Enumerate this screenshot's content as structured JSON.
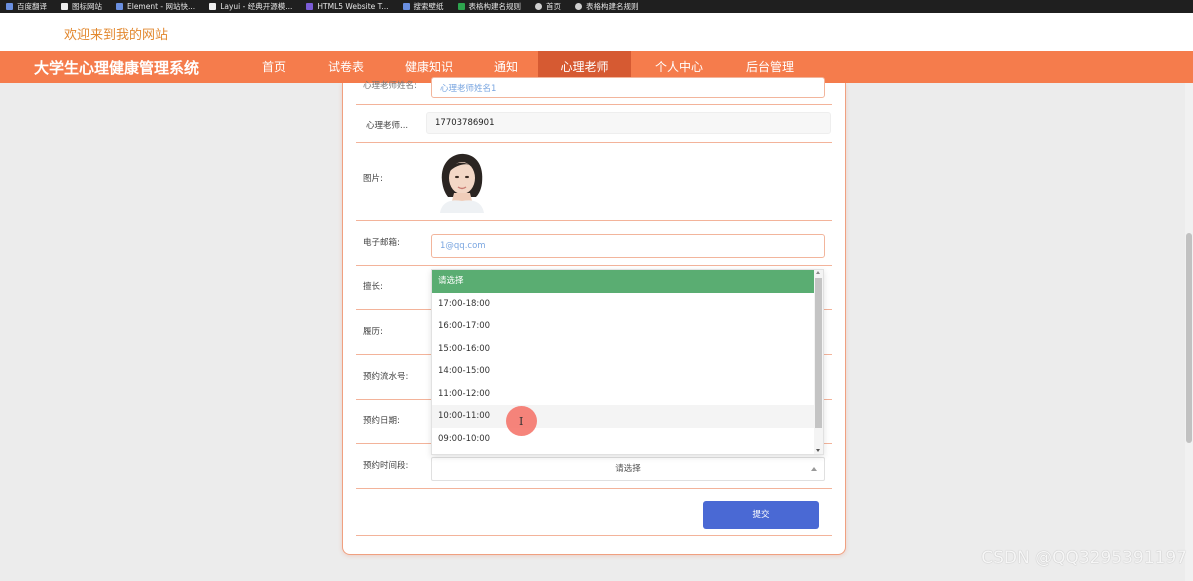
{
  "bookmarks": [
    {
      "label": "百度翻译",
      "icon": "paw-icon"
    },
    {
      "label": "图标网站",
      "icon": "page-icon"
    },
    {
      "label": "Element - 网站快...",
      "icon": "shield-icon"
    },
    {
      "label": "Layui - 经典开源模...",
      "icon": "layer-icon"
    },
    {
      "label": "HTML5 Website T...",
      "icon": "page-icon"
    },
    {
      "label": "搜索壁纸",
      "icon": "image-icon"
    },
    {
      "label": "表格构建名规则",
      "icon": "table-icon"
    },
    {
      "label": "首页",
      "icon": "globe-icon"
    },
    {
      "label": "表格构建名规则",
      "icon": "globe-icon"
    }
  ],
  "welcome": "欢迎来到我的网站",
  "site_title": "大学生心理健康管理系统",
  "nav": [
    {
      "label": "首页",
      "active": false
    },
    {
      "label": "试卷表",
      "active": false
    },
    {
      "label": "健康知识",
      "active": false
    },
    {
      "label": "通知",
      "active": false
    },
    {
      "label": "心理老师",
      "active": true
    },
    {
      "label": "个人中心",
      "active": false
    },
    {
      "label": "后台管理",
      "active": false
    }
  ],
  "form": {
    "teacher_name_label": "心理老师姓名:",
    "teacher_name_placeholder": "心理老师姓名1",
    "phone_label": "心理老师...",
    "phone_value": "17703786901",
    "image_label": "图片:",
    "email_label": "电子邮箱:",
    "email_placeholder": "1@qq.com",
    "specialty_label": "擅长:",
    "resume_label": "履历:",
    "booking_no_label": "预约流水号:",
    "booking_date_label": "预约日期:",
    "booking_time_label": "预约时间段:",
    "select_placeholder": "请选择",
    "submit_label": "提交"
  },
  "dropdown": {
    "options": [
      "请选择",
      "17:00-18:00",
      "16:00-17:00",
      "15:00-16:00",
      "14:00-15:00",
      "11:00-12:00",
      "10:00-11:00",
      "09:00-10:00"
    ],
    "selected_index": 0,
    "hover_index": 6
  },
  "colors": {
    "nav_bg": "#f57c4c",
    "nav_active": "#d65a32",
    "accent_text": "#e2882f",
    "selected_option": "#5aad72",
    "submit": "#4a69d4"
  },
  "watermark": "CSDN @QQ3295391197"
}
